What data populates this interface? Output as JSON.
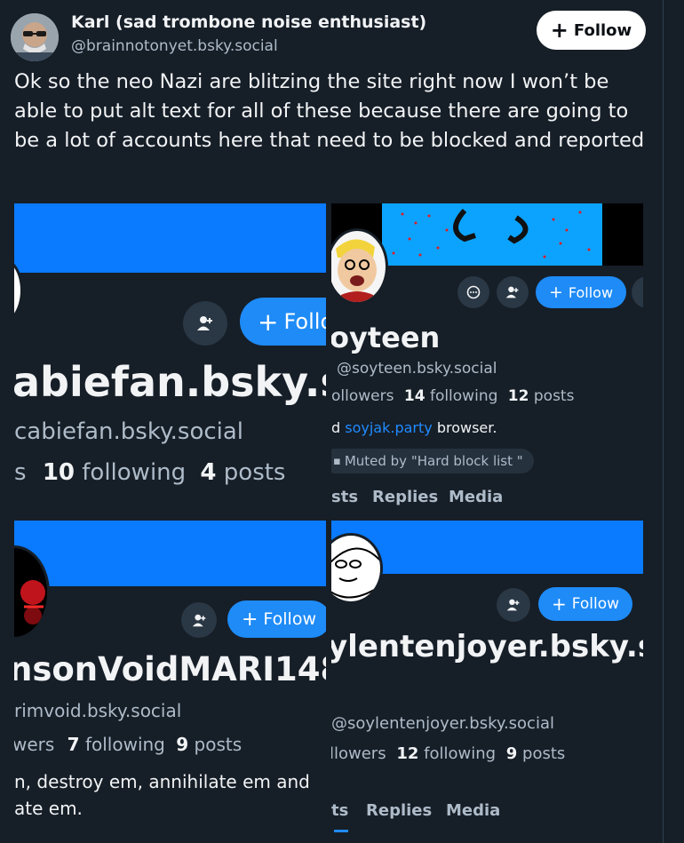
{
  "post": {
    "author_name": "Karl (sad trombone noise enthusiast)",
    "author_handle": "@brainnotonyet.bsky.social",
    "follow_label": "Follow",
    "text": "Ok so the neo Nazi are blitzing the site right now I won’t be able to put alt text for all of these because there are going to be a lot of accounts here that need to be blocked and reported"
  },
  "images": {
    "profile1": {
      "follow_label": "Follo",
      "name": "abiefan.bsky.so",
      "handle": "cabiefan.bsky.social",
      "followers_frag": "s",
      "following_count": "10",
      "following_label": "following",
      "posts_count": "4",
      "posts_label": "posts"
    },
    "profile2": {
      "follow_label": "Follow",
      "name": "oyteen",
      "handle": "@soyteen.bsky.social",
      "followers_frag": "ollowers",
      "following_count": "14",
      "following_label": "following",
      "posts_count": "12",
      "posts_label": "posts",
      "bio_prefix": "d",
      "bio_link": "soyjak.party",
      "bio_suffix": "browser.",
      "muted_label": "Muted by \"Hard block list \"",
      "tabs": [
        "sts",
        "Replies",
        "Media"
      ]
    },
    "profile3": {
      "follow_label": "Follow",
      "name": "nsonVoidMARI148",
      "handle": "rimvoid.bsky.social",
      "followers_frag": "wers",
      "following_count": "7",
      "following_label": "following",
      "posts_count": "9",
      "posts_label": "posts",
      "bio_line1": "n, destroy em, annihilate em and",
      "bio_line2": "ate em."
    },
    "profile4": {
      "follow_label": "Follow",
      "name": "ylentenjoyer.bsky.so",
      "handle": "@soylentenjoyer.bsky.social",
      "followers_frag": "llowers",
      "following_count": "12",
      "following_label": "following",
      "posts_count": "9",
      "posts_label": "posts",
      "tabs": [
        "ts",
        "Replies",
        "Media"
      ]
    }
  },
  "colors": {
    "background": "#161e27",
    "banner_blue": "#0a7aff",
    "follow_blue": "#1e8bf7",
    "link_blue": "#208bfe"
  }
}
